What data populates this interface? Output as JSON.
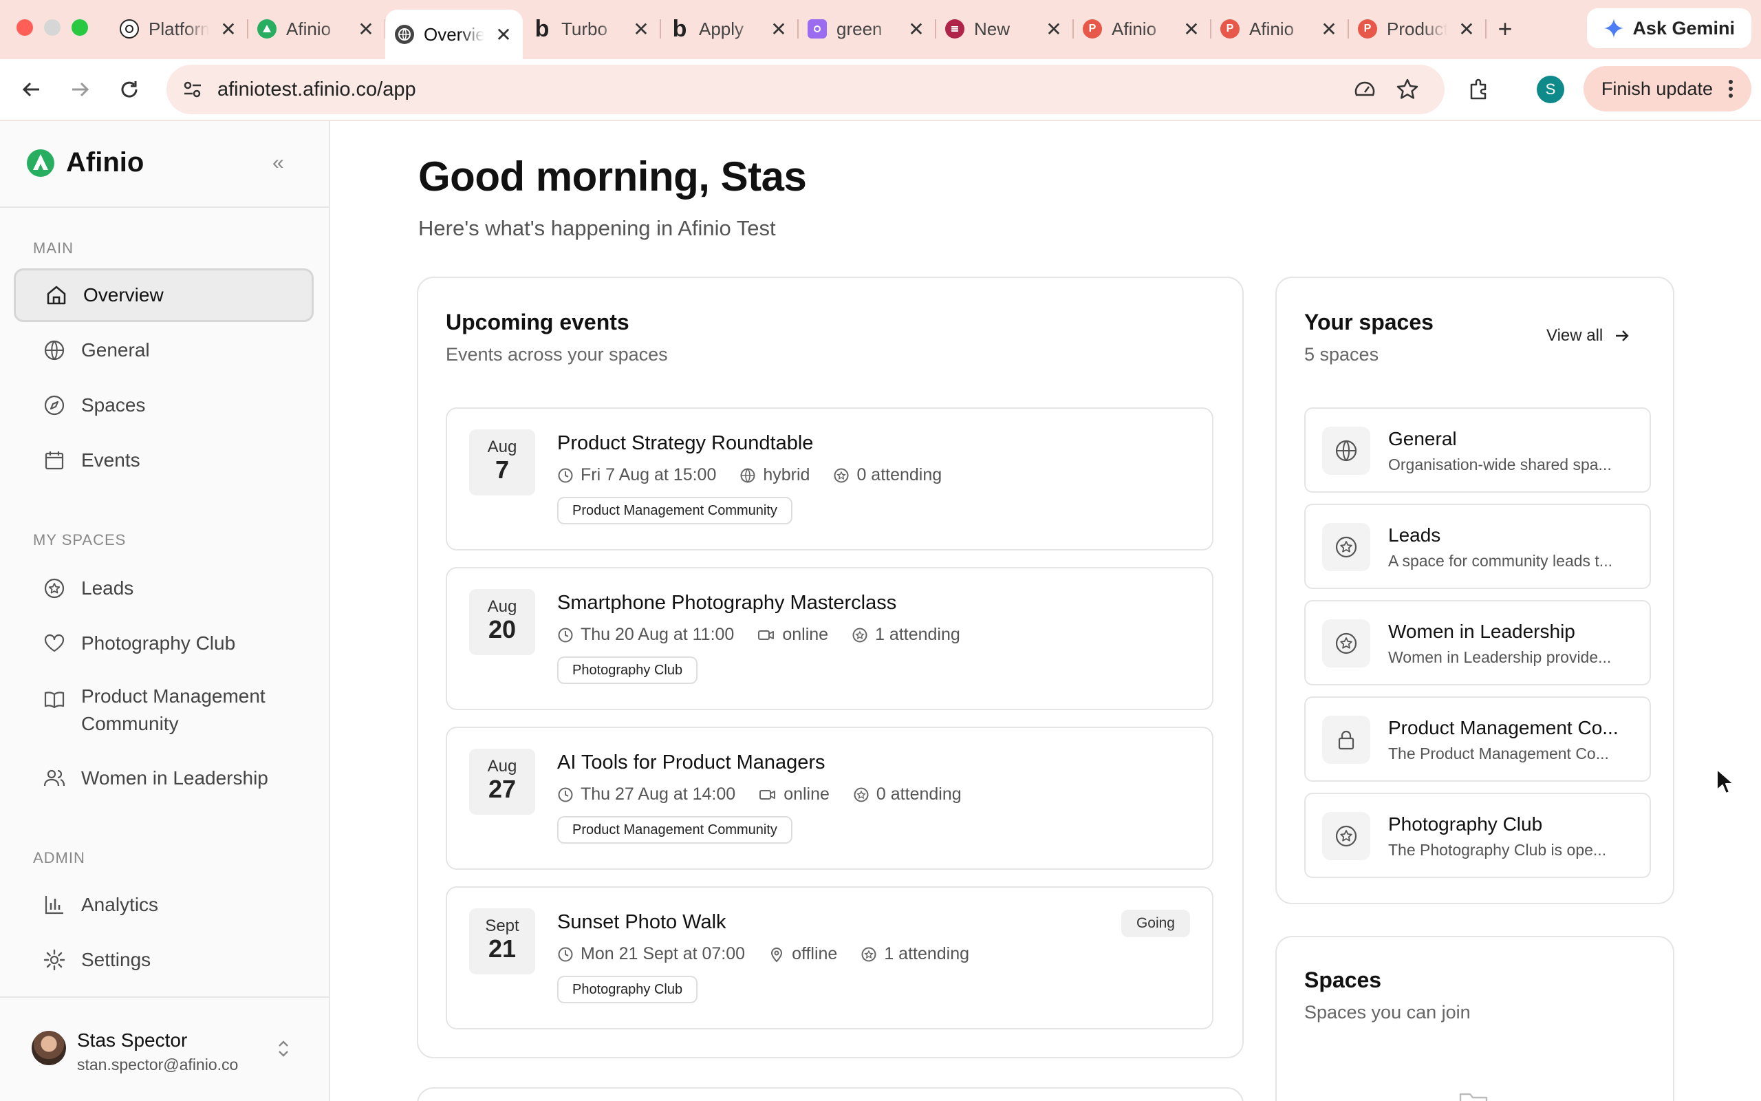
{
  "browser": {
    "tabs": [
      {
        "title": "Platform",
        "favicon": "openai-icon",
        "color": "#222222"
      },
      {
        "title": "Afinio",
        "favicon": "afinio-icon",
        "color": "#27ae60"
      },
      {
        "title": "Overview",
        "favicon": "globe-icon",
        "color": "#444444",
        "active": true
      },
      {
        "title": "Turbo",
        "favicon": "b-icon",
        "color": "#222222"
      },
      {
        "title": "Apply",
        "favicon": "b-icon",
        "color": "#222222"
      },
      {
        "title": "green",
        "favicon": "purple-icon",
        "color": "#9b6cf0"
      },
      {
        "title": "New",
        "favicon": "swirl-icon",
        "color": "#b0244a"
      },
      {
        "title": "Afinio",
        "favicon": "p-icon",
        "color": "#e8584a"
      },
      {
        "title": "Afinio",
        "favicon": "p-icon",
        "color": "#e8584a"
      },
      {
        "title": "Product",
        "favicon": "p-icon",
        "color": "#e8584a"
      }
    ],
    "tab_letters": [
      "",
      "",
      "",
      "b",
      "b",
      "",
      "",
      "P",
      "P",
      "P"
    ],
    "close_glyph": "✕",
    "new_tab_glyph": "+",
    "ask_gemini": "Ask Gemini",
    "url": "afiniotest.afinio.co/app",
    "profile_initial": "S",
    "finish_update": "Finish update"
  },
  "sidebar": {
    "brand": "Afinio",
    "collapse_glyph": "«",
    "sections": {
      "main": "MAIN",
      "my_spaces": "MY SPACES",
      "admin": "ADMIN"
    },
    "main_items": [
      {
        "label": "Overview",
        "icon": "home-icon"
      },
      {
        "label": "General",
        "icon": "globe-icon"
      },
      {
        "label": "Spaces",
        "icon": "compass-icon"
      },
      {
        "label": "Events",
        "icon": "calendar-icon"
      }
    ],
    "space_items": [
      {
        "label": "Leads",
        "icon": "star-badge-icon"
      },
      {
        "label": "Photography Club",
        "icon": "heart-icon"
      },
      {
        "label": "Product Management Community",
        "icon": "book-icon"
      },
      {
        "label": "Women in Leadership",
        "icon": "users-icon"
      }
    ],
    "admin_items": [
      {
        "label": "Analytics",
        "icon": "bar-chart-icon"
      },
      {
        "label": "Settings",
        "icon": "gear-icon"
      }
    ],
    "user": {
      "name": "Stas Spector",
      "email": "stan.spector@afinio.co",
      "chevron_glyph": "⌃⌄"
    }
  },
  "main": {
    "greeting": "Good morning, Stas",
    "subtitle": "Here's what's happening in Afinio Test",
    "events_card": {
      "title": "Upcoming events",
      "subtitle": "Events across your spaces",
      "events": [
        {
          "month": "Aug",
          "day": "7",
          "title": "Product Strategy Roundtable",
          "when": "Fri 7 Aug at 15:00",
          "mode": "hybrid",
          "mode_icon": "globe-icon",
          "attending": "0 attending",
          "tag": "Product Management Community",
          "badge": ""
        },
        {
          "month": "Aug",
          "day": "20",
          "title": "Smartphone Photography Masterclass",
          "when": "Thu 20 Aug at 11:00",
          "mode": "online",
          "mode_icon": "video-icon",
          "attending": "1 attending",
          "tag": "Photography Club",
          "badge": ""
        },
        {
          "month": "Aug",
          "day": "27",
          "title": "AI Tools for Product Managers",
          "when": "Thu 27 Aug at 14:00",
          "mode": "online",
          "mode_icon": "video-icon",
          "attending": "0 attending",
          "tag": "Product Management Community",
          "badge": ""
        },
        {
          "month": "Sept",
          "day": "21",
          "title": "Sunset Photo Walk",
          "when": "Mon 21 Sept at 07:00",
          "mode": "offline",
          "mode_icon": "pin-icon",
          "attending": "1 attending",
          "tag": "Photography Club",
          "badge": "Going"
        }
      ]
    },
    "spaces_card": {
      "title": "Your spaces",
      "count": "5 spaces",
      "view_all": "View all",
      "spaces": [
        {
          "name": "General",
          "desc": "Organisation-wide shared spa...",
          "icon": "globe-icon"
        },
        {
          "name": "Leads",
          "desc": "A space for community leads t...",
          "icon": "star-badge-icon"
        },
        {
          "name": "Women in Leadership",
          "desc": "Women in Leadership provide...",
          "icon": "star-badge-icon"
        },
        {
          "name": "Product Management Co...",
          "desc": "The Product Management Co...",
          "icon": "lock-icon"
        },
        {
          "name": "Photography Club",
          "desc": "The Photography Club is ope...",
          "icon": "star-badge-icon"
        }
      ]
    },
    "join_card": {
      "title": "Spaces",
      "subtitle": "Spaces you can join"
    }
  },
  "colors": {
    "tabbar": "#fbe1db",
    "brand_green": "#27ae60",
    "close": "#ff5f57",
    "minimize": "#d9d9d9",
    "zoom": "#28c840"
  }
}
